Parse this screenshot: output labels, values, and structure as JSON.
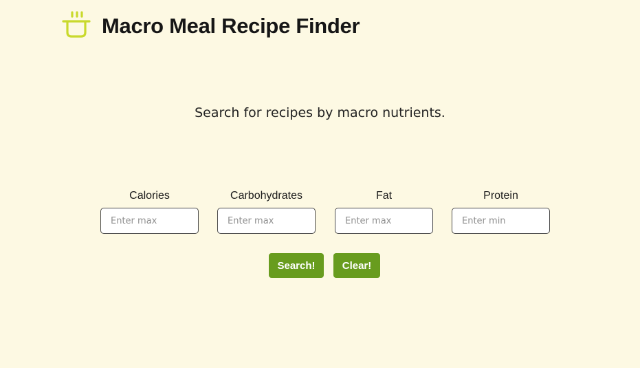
{
  "header": {
    "title": "Macro Meal Recipe Finder",
    "logo_icon": "pot-icon",
    "logo_color": "#c9d92c"
  },
  "intro": {
    "text": "Search for recipes by macro nutrients."
  },
  "fields": [
    {
      "label": "Calories",
      "placeholder": "Enter max",
      "value": ""
    },
    {
      "label": "Carbohydrates",
      "placeholder": "Enter max",
      "value": ""
    },
    {
      "label": "Fat",
      "placeholder": "Enter max",
      "value": ""
    },
    {
      "label": "Protein",
      "placeholder": "Enter min",
      "value": ""
    }
  ],
  "actions": {
    "search_label": "Search!",
    "clear_label": "Clear!"
  },
  "colors": {
    "background": "#fdf9e3",
    "button": "#689c1e",
    "button_text": "#ffffff"
  }
}
